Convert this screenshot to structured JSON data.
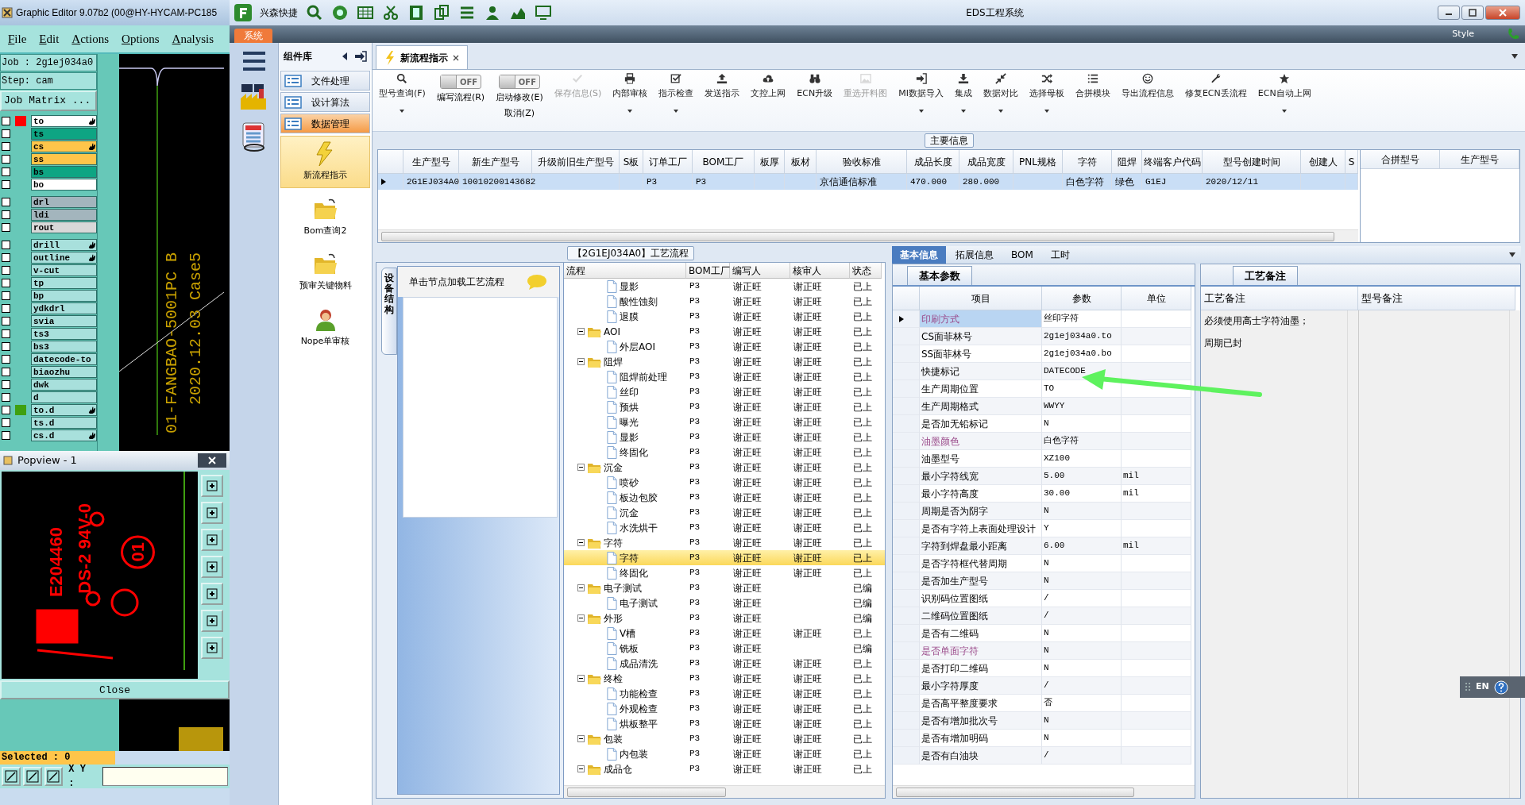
{
  "graphic_editor": {
    "title": "Graphic Editor 9.07b2 (00@HY-HYCAM-PC185",
    "menu": [
      "File",
      "Edit",
      "Actions",
      "Options",
      "Analysis"
    ],
    "job": "Job : 2g1ej034a0",
    "step": "Step: cam",
    "job_matrix_button": "Job Matrix ...",
    "layer_groups": [
      {
        "layers": [
          {
            "name": "to",
            "color": "#ffffff",
            "checked": false,
            "swatch": {
              "color": "#ff0000"
            },
            "marked": true
          },
          {
            "name": "ts",
            "color": "#0ea583",
            "checked": false,
            "marked": false
          },
          {
            "name": "cs",
            "color": "#ffc54a",
            "checked": false,
            "marked": true
          },
          {
            "name": "ss",
            "color": "#ffc54a",
            "checked": false,
            "marked": false
          },
          {
            "name": "bs",
            "color": "#0ea583",
            "checked": false,
            "marked": false
          },
          {
            "name": "bo",
            "color": "#ffffff",
            "checked": false,
            "marked": false
          }
        ]
      },
      {
        "layers": [
          {
            "name": "drl",
            "color": "#a3b5bd",
            "checked": false,
            "marked": false
          },
          {
            "name": "ldi",
            "color": "#a3b5bd",
            "checked": false,
            "marked": false
          },
          {
            "name": "rout",
            "color": "#d8d8d8",
            "checked": false,
            "marked": false
          }
        ]
      },
      {
        "layers": [
          {
            "name": "drill",
            "color": "#a8e0dc",
            "checked": false,
            "marked": true
          },
          {
            "name": "outline",
            "color": "#a8e0dc",
            "checked": false,
            "marked": true
          },
          {
            "name": "v-cut",
            "color": "#a8e0dc",
            "checked": false,
            "marked": false
          },
          {
            "name": "tp",
            "color": "#a8e0dc",
            "checked": false,
            "marked": false
          },
          {
            "name": "bp",
            "color": "#a8e0dc",
            "checked": false,
            "marked": false
          },
          {
            "name": "ydkdrl",
            "color": "#a8e0dc",
            "checked": false,
            "marked": false
          },
          {
            "name": "svia",
            "color": "#a8e0dc",
            "checked": false,
            "marked": false
          },
          {
            "name": "ts3",
            "color": "#a8e0dc",
            "checked": false,
            "marked": false
          },
          {
            "name": "bs3",
            "color": "#a8e0dc",
            "checked": false,
            "marked": false
          },
          {
            "name": "datecode-to",
            "color": "#a8e0dc",
            "checked": false,
            "marked": false
          },
          {
            "name": "biaozhu",
            "color": "#a8e0dc",
            "checked": false,
            "marked": false
          },
          {
            "name": "dwk",
            "color": "#a8e0dc",
            "checked": false,
            "marked": false
          },
          {
            "name": "d",
            "color": "#a8e0dc",
            "checked": false,
            "marked": false
          },
          {
            "name": "to.d",
            "color": "#a8e0dc",
            "checked": false,
            "swatch": {
              "color": "#3fa010"
            },
            "marked": true
          },
          {
            "name": "ts.d",
            "color": "#a8e0dc",
            "checked": false,
            "marked": false
          },
          {
            "name": "cs.d",
            "color": "#a8e0dc",
            "checked": false,
            "marked": true
          }
        ]
      }
    ],
    "canvas_text": [
      "01-FANGBAO-5001PC B",
      "2020.12.03 Case5"
    ],
    "popview": {
      "title": "Popview - 1",
      "texts": [
        "E204460",
        "DS-2 94V-0",
        "01"
      ],
      "close_button": "Close"
    },
    "selected": "Selected : 0",
    "xy_label": "X Y :"
  },
  "app": {
    "quick_title": "兴森快捷",
    "title": "EDS工程系统",
    "ribbon_tab": "系统",
    "style_label": "Style"
  },
  "sidebar": {
    "title": "组件库",
    "groups": [
      {
        "label": "文件处理",
        "selected": false
      },
      {
        "label": "设计算法",
        "selected": false
      },
      {
        "label": "数据管理",
        "selected": true
      }
    ],
    "items": [
      {
        "label": "新流程指示",
        "selected": true
      },
      {
        "label": "Bom查询2",
        "selected": false
      },
      {
        "label": "预审关键物料",
        "selected": false
      },
      {
        "label": "Nope单审核",
        "selected": false
      }
    ]
  },
  "doc_tabs": [
    {
      "label": "新流程指示",
      "selected": true
    }
  ],
  "toolbar": [
    {
      "kind": "button",
      "label": "型号查询(F)",
      "dropdown": true,
      "disabled": false
    },
    {
      "kind": "toggle",
      "label": "编写流程(R)",
      "toggle_text": "OFF",
      "on": false
    },
    {
      "kind": "toggle",
      "label": "启动修改(E)",
      "sublabel": "取消(Z)",
      "toggle_text": "OFF",
      "on": false
    },
    {
      "kind": "button",
      "label": "保存信息(S)",
      "dropdown": false,
      "disabled": true
    },
    {
      "kind": "button",
      "label": "内部审核",
      "dropdown": true,
      "disabled": false
    },
    {
      "kind": "button",
      "label": "指示检查",
      "dropdown": true,
      "disabled": false
    },
    {
      "kind": "button",
      "label": "发送指示",
      "dropdown": false,
      "disabled": false
    },
    {
      "kind": "button",
      "label": "文控上网",
      "dropdown": false,
      "disabled": false
    },
    {
      "kind": "button",
      "label": "ECN升级",
      "dropdown": false,
      "disabled": false
    },
    {
      "kind": "button",
      "label": "重选开料图",
      "dropdown": false,
      "disabled": true
    },
    {
      "kind": "button",
      "label": "MI数据导入",
      "dropdown": true,
      "disabled": false
    },
    {
      "kind": "button",
      "label": "集成",
      "dropdown": true,
      "disabled": false
    },
    {
      "kind": "button",
      "label": "数据对比",
      "dropdown": true,
      "disabled": false
    },
    {
      "kind": "button",
      "label": "选择母板",
      "dropdown": true,
      "disabled": false
    },
    {
      "kind": "button",
      "label": "合拼模块",
      "dropdown": false,
      "disabled": false
    },
    {
      "kind": "button",
      "label": "导出流程信息",
      "dropdown": false,
      "disabled": false
    },
    {
      "kind": "button",
      "label": "修复ECN丢流程",
      "dropdown": false,
      "disabled": false
    },
    {
      "kind": "button",
      "label": "ECN自动上网",
      "dropdown": true,
      "disabled": false
    }
  ],
  "main_info": {
    "title": "主要信息",
    "columns": [
      "生产型号",
      "新生产型号",
      "升级前旧生产型号",
      "S板",
      "订单工厂",
      "BOM工厂",
      "板厚",
      "板材",
      "验收标准",
      "成品长度",
      "成品宽度",
      "PNL规格",
      "字符",
      "阻焊",
      "终端客户代码",
      "型号创建时间",
      "创建人",
      "S"
    ],
    "rows": [
      {
        "selected": true,
        "cells": [
          "2G1EJ034A0",
          "10010200143682",
          null,
          null,
          "P3",
          "P3",
          null,
          null,
          "京信通信标准",
          "470.000",
          "280.000",
          null,
          "白色字符",
          "绿色",
          "G1EJ",
          "2020/12/11",
          null,
          null
        ]
      }
    ],
    "side_columns": [
      "合拼型号",
      "生产型号"
    ]
  },
  "process": {
    "title": "【2G1EJ034A0】工艺流程",
    "side_tab": "设备结构",
    "hint": "单击节点加载工艺流程",
    "columns": [
      "流程",
      "BOM工厂",
      "编写人",
      "核审人",
      "状态"
    ],
    "rows": [
      {
        "kind": "file",
        "label": "显影",
        "bom_factory": "P3",
        "writer": "谢正旺",
        "reviewer": "谢正旺",
        "status": "已上",
        "selected": false
      },
      {
        "kind": "file",
        "label": "酸性蚀刻",
        "bom_factory": "P3",
        "writer": "谢正旺",
        "reviewer": "谢正旺",
        "status": "已上",
        "selected": false
      },
      {
        "kind": "file",
        "label": "退膜",
        "bom_factory": "P3",
        "writer": "谢正旺",
        "reviewer": "谢正旺",
        "status": "已上",
        "selected": false
      },
      {
        "kind": "folder",
        "label": "AOI",
        "bom_factory": "P3",
        "writer": "谢正旺",
        "reviewer": "谢正旺",
        "status": "已上",
        "selected": false,
        "expanded": true,
        "children": [
          {
            "kind": "file",
            "label": "外层AOI",
            "bom_factory": "P3",
            "writer": "谢正旺",
            "reviewer": "谢正旺",
            "status": "已上",
            "selected": false
          }
        ]
      },
      {
        "kind": "folder",
        "label": "阻焊",
        "bom_factory": "P3",
        "writer": "谢正旺",
        "reviewer": "谢正旺",
        "status": "已上",
        "selected": false,
        "expanded": true,
        "children": [
          {
            "kind": "file",
            "label": "阻焊前处理",
            "bom_factory": "P3",
            "writer": "谢正旺",
            "reviewer": "谢正旺",
            "status": "已上",
            "selected": false
          },
          {
            "kind": "file",
            "label": "丝印",
            "bom_factory": "P3",
            "writer": "谢正旺",
            "reviewer": "谢正旺",
            "status": "已上",
            "selected": false
          },
          {
            "kind": "file",
            "label": "预烘",
            "bom_factory": "P3",
            "writer": "谢正旺",
            "reviewer": "谢正旺",
            "status": "已上",
            "selected": false
          },
          {
            "kind": "file",
            "label": "曝光",
            "bom_factory": "P3",
            "writer": "谢正旺",
            "reviewer": "谢正旺",
            "status": "已上",
            "selected": false
          },
          {
            "kind": "file",
            "label": "显影",
            "bom_factory": "P3",
            "writer": "谢正旺",
            "reviewer": "谢正旺",
            "status": "已上",
            "selected": false
          },
          {
            "kind": "file",
            "label": "终固化",
            "bom_factory": "P3",
            "writer": "谢正旺",
            "reviewer": "谢正旺",
            "status": "已上",
            "selected": false
          }
        ]
      },
      {
        "kind": "folder",
        "label": "沉金",
        "bom_factory": "P3",
        "writer": "谢正旺",
        "reviewer": "谢正旺",
        "status": "已上",
        "selected": false,
        "expanded": true,
        "children": [
          {
            "kind": "file",
            "label": "喷砂",
            "bom_factory": "P3",
            "writer": "谢正旺",
            "reviewer": "谢正旺",
            "status": "已上",
            "selected": false
          },
          {
            "kind": "file",
            "label": "板边包胶",
            "bom_factory": "P3",
            "writer": "谢正旺",
            "reviewer": "谢正旺",
            "status": "已上",
            "selected": false
          },
          {
            "kind": "file",
            "label": "沉金",
            "bom_factory": "P3",
            "writer": "谢正旺",
            "reviewer": "谢正旺",
            "status": "已上",
            "selected": false
          },
          {
            "kind": "file",
            "label": "水洗烘干",
            "bom_factory": "P3",
            "writer": "谢正旺",
            "reviewer": "谢正旺",
            "status": "已上",
            "selected": false
          }
        ]
      },
      {
        "kind": "folder",
        "label": "字符",
        "bom_factory": "P3",
        "writer": "谢正旺",
        "reviewer": "谢正旺",
        "status": "已上",
        "selected": false,
        "expanded": true,
        "children": [
          {
            "kind": "file",
            "label": "字符",
            "bom_factory": "P3",
            "writer": "谢正旺",
            "reviewer": "谢正旺",
            "status": "已上",
            "selected": true
          },
          {
            "kind": "file",
            "label": "终固化",
            "bom_factory": "P3",
            "writer": "谢正旺",
            "reviewer": "谢正旺",
            "status": "已上",
            "selected": false
          }
        ]
      },
      {
        "kind": "folder",
        "label": "电子测试",
        "bom_factory": "P3",
        "writer": "谢正旺",
        "status": "已编",
        "selected": false,
        "expanded": true,
        "children": [
          {
            "kind": "file",
            "label": "电子测试",
            "bom_factory": "P3",
            "writer": "谢正旺",
            "status": "已编",
            "selected": false
          }
        ]
      },
      {
        "kind": "folder",
        "label": "外形",
        "bom_factory": "P3",
        "writer": "谢正旺",
        "status": "已编",
        "selected": false,
        "expanded": true,
        "children": [
          {
            "kind": "file",
            "label": "V槽",
            "bom_factory": "P3",
            "writer": "谢正旺",
            "reviewer": "谢正旺",
            "status": "已上",
            "selected": false
          },
          {
            "kind": "file",
            "label": "铣板",
            "bom_factory": "P3",
            "writer": "谢正旺",
            "status": "已编",
            "selected": false
          },
          {
            "kind": "file",
            "label": "成品清洗",
            "bom_factory": "P3",
            "writer": "谢正旺",
            "reviewer": "谢正旺",
            "status": "已上",
            "selected": false
          }
        ]
      },
      {
        "kind": "folder",
        "label": "终检",
        "bom_factory": "P3",
        "writer": "谢正旺",
        "reviewer": "谢正旺",
        "status": "已上",
        "selected": false,
        "expanded": true,
        "children": [
          {
            "kind": "file",
            "label": "功能检查",
            "bom_factory": "P3",
            "writer": "谢正旺",
            "reviewer": "谢正旺",
            "status": "已上",
            "selected": false
          },
          {
            "kind": "file",
            "label": "外观检查",
            "bom_factory": "P3",
            "writer": "谢正旺",
            "reviewer": "谢正旺",
            "status": "已上",
            "selected": false
          },
          {
            "kind": "file",
            "label": "烘板整平",
            "bom_factory": "P3",
            "writer": "谢正旺",
            "reviewer": "谢正旺",
            "status": "已上",
            "selected": false
          }
        ]
      },
      {
        "kind": "folder",
        "label": "包装",
        "bom_factory": "P3",
        "writer": "谢正旺",
        "reviewer": "谢正旺",
        "status": "已上",
        "selected": false,
        "expanded": true,
        "children": [
          {
            "kind": "file",
            "label": "内包装",
            "bom_factory": "P3",
            "writer": "谢正旺",
            "reviewer": "谢正旺",
            "status": "已上",
            "selected": false
          }
        ]
      },
      {
        "kind": "folder",
        "label": "成品仓",
        "bom_factory": "P3",
        "writer": "谢正旺",
        "reviewer": "谢正旺",
        "status": "已上",
        "selected": false,
        "expanded": true
      }
    ]
  },
  "details": {
    "tabs": [
      {
        "label": "基本信息",
        "selected": true
      },
      {
        "label": "拓展信息",
        "selected": false
      },
      {
        "label": "BOM",
        "selected": false
      },
      {
        "label": "工时",
        "selected": false
      }
    ],
    "sub_tab": "基本参数",
    "columns": [
      "项目",
      "参数",
      "单位"
    ],
    "rows": [
      {
        "item": "印刷方式",
        "value": "丝印字符",
        "emphasized": true,
        "selected": true
      },
      {
        "item": "CS面菲林号",
        "value": "2g1ej034a0.to",
        "emphasized": false,
        "selected": false
      },
      {
        "item": "SS面菲林号",
        "value": "2g1ej034a0.bo",
        "emphasized": false,
        "selected": false
      },
      {
        "item": "快捷标记",
        "value": "DATECODE",
        "emphasized": false,
        "selected": false
      },
      {
        "item": "生产周期位置",
        "value": "TO",
        "emphasized": false,
        "selected": false
      },
      {
        "item": "生产周期格式",
        "value": "WWYY",
        "emphasized": false,
        "selected": false
      },
      {
        "item": "是否加无铅标记",
        "value": "N",
        "emphasized": false,
        "selected": false
      },
      {
        "item": "油墨颜色",
        "value": "白色字符",
        "emphasized": true,
        "selected": false
      },
      {
        "item": "油墨型号",
        "value": "XZ100",
        "emphasized": false,
        "selected": false
      },
      {
        "item": "最小字符线宽",
        "value": "5.00",
        "unit": "mil",
        "emphasized": false,
        "selected": false
      },
      {
        "item": "最小字符高度",
        "value": "30.00",
        "unit": "mil",
        "emphasized": false,
        "selected": false
      },
      {
        "item": "周期是否为阴字",
        "value": "N",
        "emphasized": false,
        "selected": false
      },
      {
        "item": "是否有字符上表面处理设计",
        "value": "Y",
        "emphasized": false,
        "selected": false
      },
      {
        "item": "字符到焊盘最小距离",
        "value": "6.00",
        "unit": "mil",
        "emphasized": false,
        "selected": false
      },
      {
        "item": "是否字符框代替周期",
        "value": "N",
        "emphasized": false,
        "selected": false
      },
      {
        "item": "是否加生产型号",
        "value": "N",
        "emphasized": false,
        "selected": false
      },
      {
        "item": "识别码位置图纸",
        "value": "/",
        "emphasized": false,
        "selected": false
      },
      {
        "item": "二维码位置图纸",
        "value": "/",
        "emphasized": false,
        "selected": false
      },
      {
        "item": "是否有二维码",
        "value": "N",
        "emphasized": false,
        "selected": false
      },
      {
        "item": "是否单面字符",
        "value": "N",
        "emphasized": true,
        "selected": false
      },
      {
        "item": "是否打印二维码",
        "value": "N",
        "emphasized": false,
        "selected": false
      },
      {
        "item": "最小字符厚度",
        "value": "/",
        "emphasized": false,
        "selected": false
      },
      {
        "item": "是否高平整度要求",
        "value": "否",
        "emphasized": false,
        "selected": false
      },
      {
        "item": "是否有增加批次号",
        "value": "N",
        "emphasized": false,
        "selected": false
      },
      {
        "item": "是否有增加明码",
        "value": "N",
        "emphasized": false,
        "selected": false
      },
      {
        "item": "是否有白油块",
        "value": "/",
        "emphasized": false,
        "selected": false
      }
    ],
    "notes_tab": "工艺备注",
    "notes_columns": [
      "工艺备注",
      "型号备注"
    ],
    "notes": [
      "必须使用高士字符油墨；",
      "周期已封"
    ]
  },
  "ime": {
    "label": "EN"
  }
}
